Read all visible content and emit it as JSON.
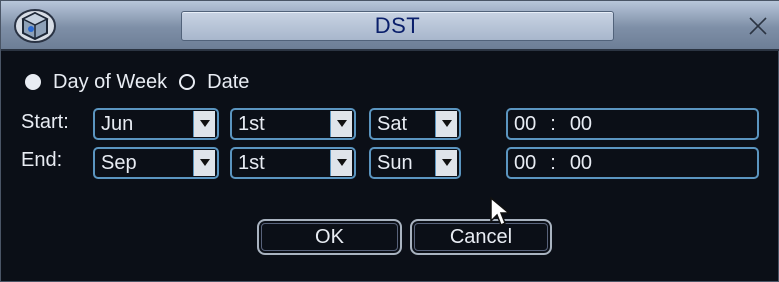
{
  "dialog": {
    "title": "DST",
    "close_glyph": "×"
  },
  "mode": {
    "options": [
      {
        "label": "Day of Week",
        "checked": true
      },
      {
        "label": "Date",
        "checked": false
      }
    ]
  },
  "start": {
    "label": "Start:",
    "month": "Jun",
    "week": "1st",
    "day": "Sat",
    "hour": "00",
    "separator": ":",
    "minute": "00"
  },
  "end": {
    "label": "End:",
    "month": "Sep",
    "week": "1st",
    "day": "Sun",
    "hour": "00",
    "separator": ":",
    "minute": "00"
  },
  "buttons": {
    "ok": "OK",
    "cancel": "Cancel"
  },
  "icons": {
    "logo": "cube-logo-icon",
    "close": "close-icon",
    "dropdown": "chevron-down-icon",
    "cursor": "mouse-pointer-icon"
  },
  "colors": {
    "background": "#0b0f17",
    "accent_border": "#5b95c0",
    "title_text": "#0a1f6b",
    "text": "#e8ecf3"
  }
}
